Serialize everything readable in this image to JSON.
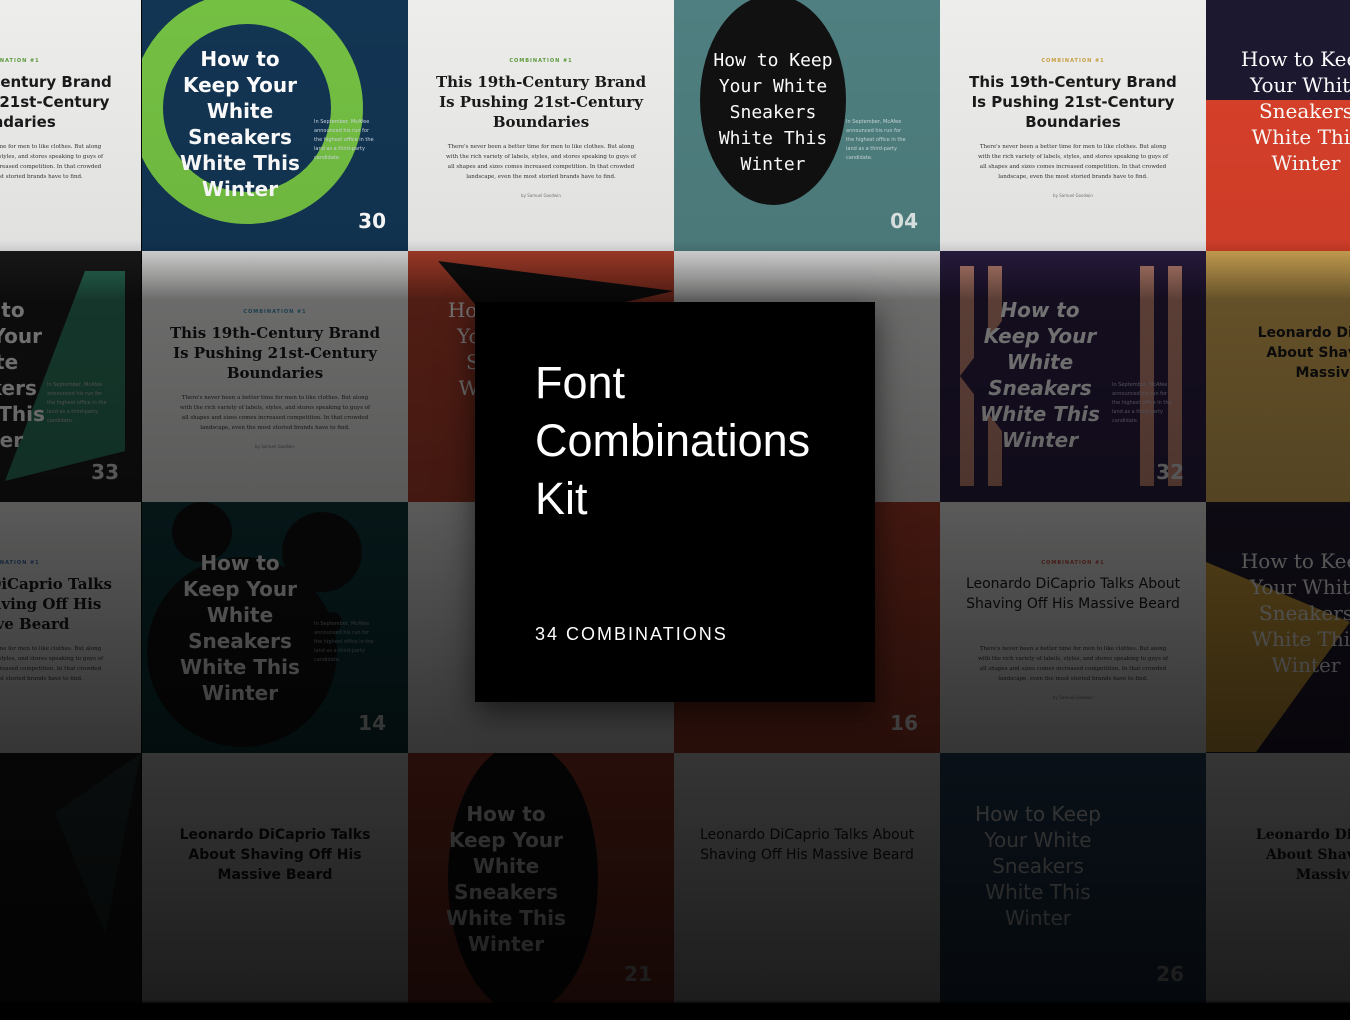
{
  "card": {
    "title_line1": "Font",
    "title_line2": "Combinations",
    "title_line3": "Kit",
    "subtitle": "34 COMBINATIONS"
  },
  "samples": {
    "combination_label": "COMBINATION #1",
    "brand_headline": "This 19th-Century Brand Is Pushing 21st-Century Boundaries",
    "sneakers_headline": "How to Keep Your White Sneakers White This Winter",
    "dicaprio_headline": "Leonardo DiCaprio Talks About Shaving Off His Massive Beard",
    "body_text": "There's never been a better time for men to like clothes. But along with the rich variety of labels, styles, and stores speaking to guys of all shapes and sizes comes increased competition. In that crowded landscape, even the most storied brands have to find.",
    "side_text": "In September, McAfee announced his run for the highest office in the land as a third-party candidate.",
    "byline": "by Samuel Goodwin"
  },
  "tile_numbers": [
    "30",
    "04",
    "33",
    "32",
    "14",
    "16",
    "21",
    "26"
  ],
  "colors": {
    "card_bg": "#000000",
    "card_text": "#ffffff",
    "green": "#74c043",
    "navy": "#123553",
    "teal": "#4f7f80",
    "orange": "#d8402a",
    "purple": "#322347",
    "salmon": "#c88a78",
    "mustard": "#ddb25a"
  }
}
